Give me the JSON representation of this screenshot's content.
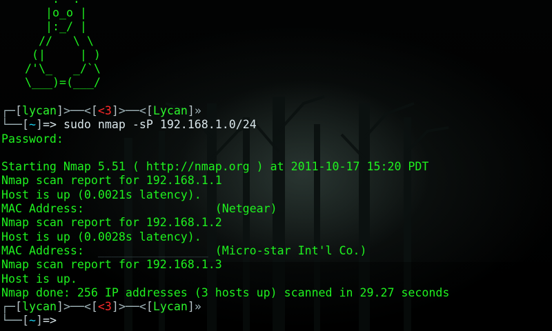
{
  "ascii_art": [
    "    .--.",
    "   |o_o |",
    "   |:_/ |",
    "  //   \\ \\",
    " (|     | )",
    "/'\\_   _/`\\",
    "\\___)=(___/"
  ],
  "prompt1": {
    "user": "lycan",
    "count": "<3",
    "host": "Lycan",
    "tilde": "~",
    "arrow": "=>",
    "command": " sudo nmap -sP 192.168.1.0/24"
  },
  "output": {
    "password": "Password:",
    "starting": "Starting Nmap 5.51 ( http://nmap.org ) at 2011-10-17 15:20 PDT",
    "report1": "Nmap scan report for 192.168.1.1",
    "up1": "Host is up (0.0021s latency).",
    "mac1_label": "MAC Address:",
    "mac1_vendor": "(Netgear)",
    "report2": "Nmap scan report for 192.168.1.2",
    "up2": "Host is up (0.0028s latency).",
    "mac2_label": "MAC Address:",
    "mac2_vendor": "(Micro-star Int'l Co.)",
    "report3": "Nmap scan report for 192.168.1.3",
    "up3": "Host is up.",
    "done": "Nmap done: 256 IP addresses (3 hosts up) scanned in 29.27 seconds"
  },
  "prompt2": {
    "user": "lycan",
    "count": "<3",
    "host": "Lycan",
    "tilde": "~",
    "arrow": "=>"
  }
}
